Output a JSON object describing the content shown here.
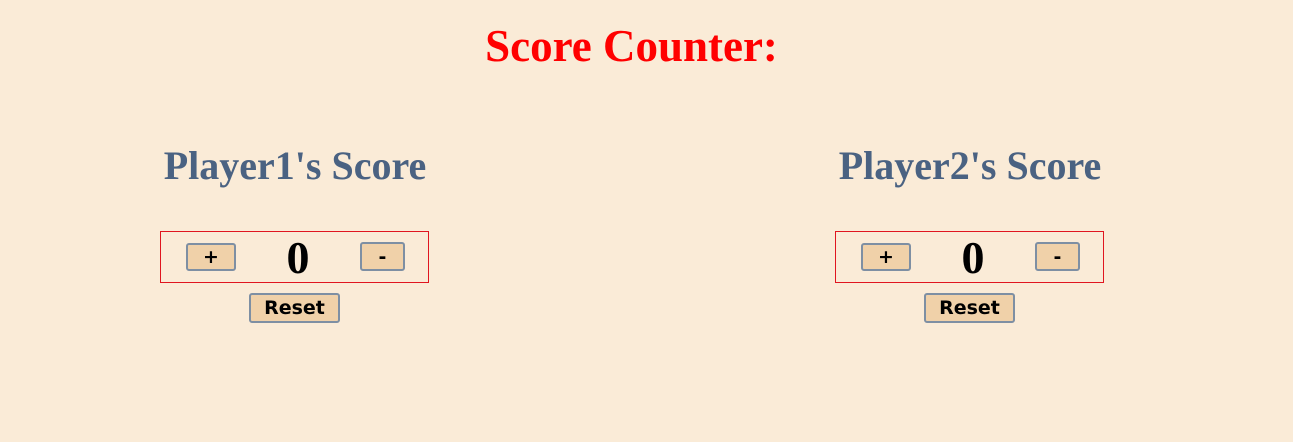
{
  "page": {
    "title": "Score Counter:",
    "colors": {
      "background": "#faebd7",
      "title": "#ff0000",
      "heading": "#4a6282",
      "box_border": "#e0151f",
      "button_fill": "#f0d1a9",
      "button_border": "#7e8fa3"
    }
  },
  "players": [
    {
      "heading": "Player1's Score",
      "increment_label": "+",
      "score": "0",
      "decrement_label": "-",
      "reset_label": "Reset"
    },
    {
      "heading": "Player2's Score",
      "increment_label": "+",
      "score": "0",
      "decrement_label": "-",
      "reset_label": "Reset"
    }
  ]
}
